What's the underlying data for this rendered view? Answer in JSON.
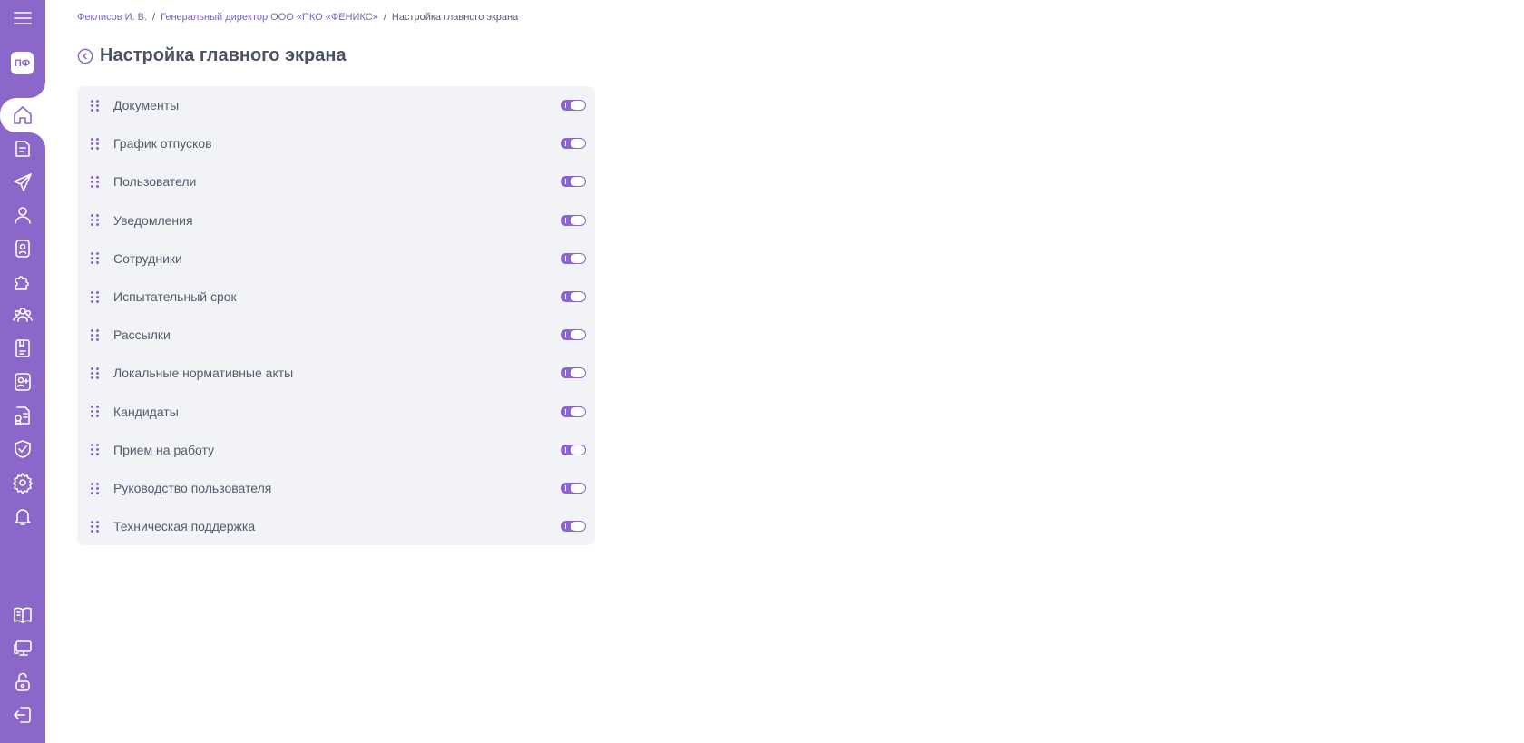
{
  "breadcrumb": {
    "items": [
      "Феклисов И. В.",
      "Генеральный директор ООО «ПКО «ФЕНИКС»",
      "Настройка главного экрана"
    ],
    "separator": "/"
  },
  "page": {
    "title": "Настройка главного экрана"
  },
  "user": {
    "initials": "ПФ"
  },
  "sidebar": {
    "icons": [
      "menu-icon",
      "home-icon",
      "documents-icon",
      "send-icon",
      "user-icon",
      "badge-icon",
      "puzzle-icon",
      "team-icon",
      "journal-icon",
      "add-contact-icon",
      "certificate-icon",
      "shield-icon",
      "gear-icon",
      "bell-icon",
      "book-icon",
      "monitor-icon",
      "unlock-icon",
      "logout-icon"
    ],
    "active": "home-icon"
  },
  "settings": {
    "items": [
      {
        "label": "Документы",
        "enabled": true
      },
      {
        "label": "График отпусков",
        "enabled": true
      },
      {
        "label": "Пользователи",
        "enabled": true
      },
      {
        "label": "Уведомления",
        "enabled": true
      },
      {
        "label": "Сотрудники",
        "enabled": true
      },
      {
        "label": "Испытательный срок",
        "enabled": true
      },
      {
        "label": "Рассылки",
        "enabled": true
      },
      {
        "label": "Локальные нормативные акты",
        "enabled": true
      },
      {
        "label": "Кандидаты",
        "enabled": true
      },
      {
        "label": "Прием на работу",
        "enabled": true
      },
      {
        "label": "Руководство пользователя",
        "enabled": true
      },
      {
        "label": "Техническая поддержка",
        "enabled": true
      }
    ]
  },
  "colors": {
    "accent": "#8a67c9",
    "text": "#555b6b",
    "card_bg": "#f2f3f7"
  }
}
